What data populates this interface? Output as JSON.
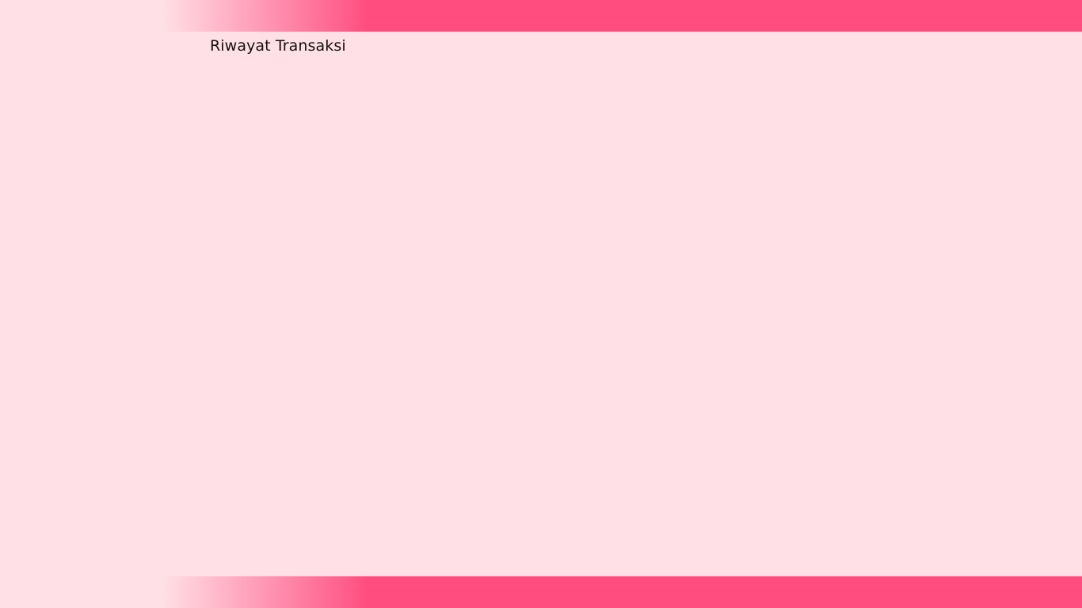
{
  "header": {
    "accent_color": "#FF4D7F"
  },
  "main": {
    "title": "Riwayat Transaksi",
    "background_color": "#FFE0E6"
  },
  "footer": {
    "accent_color": "#FF4D7F"
  }
}
